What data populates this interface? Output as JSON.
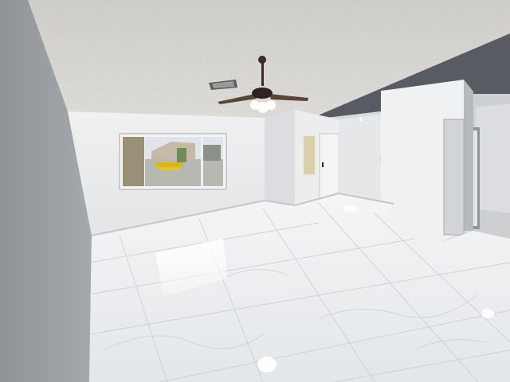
{
  "scene": {
    "subject": "empty-room-interior",
    "colors": {
      "ceiling": "#d6d5d2",
      "wall_light": "#ebebec",
      "wall_shadow": "#9a9c9f",
      "accent_wall": "#585b61",
      "floor": "#eef0f2",
      "floor_vein": "#c8ccd2",
      "car": "#e2c430",
      "fan_body": "#3b2c26"
    },
    "icons": [
      "ceiling-fan-icon",
      "air-vent-icon",
      "light-globe-icon"
    ]
  }
}
